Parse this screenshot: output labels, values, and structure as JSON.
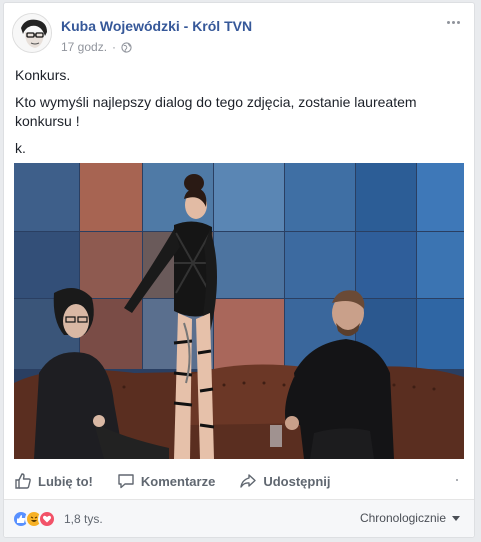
{
  "post": {
    "author": "Kuba Wojewódzki - Król TVN",
    "time": "17 godz.",
    "paragraphs": [
      "Konkurs.",
      "Kto wymyśli najlepszy dialog do tego zdjęcia, zostanie laureatem konkursu !",
      "k."
    ]
  },
  "actions": {
    "like": "Lubię to!",
    "comment": "Komentarze",
    "share": "Udostępnij"
  },
  "footer": {
    "reaction_count": "1,8 tys.",
    "sort_label": "Chronologicznie"
  },
  "colors": {
    "link": "#365899",
    "like_blue": "#5890ff",
    "haha_yellow": "#f7b125",
    "love_red": "#f25268"
  }
}
